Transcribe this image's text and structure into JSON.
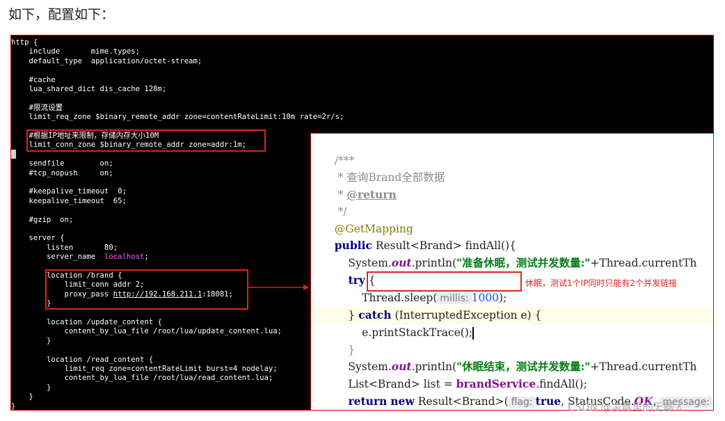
{
  "heading": "如下，配置如下：",
  "terminal": {
    "lines": [
      "http {",
      "    include       mime.types;",
      "    default_type  application/octet-stream;",
      "",
      "    #cache",
      "    lua_shared_dict dis_cache 128m;",
      "",
      "    #限流设置",
      "    limit_req_zone $binary_remote_addr zone=contentRateLimit:10m rate=2r/s;",
      "",
      "    #根据IP地址来限制，存储内存大小10M",
      "    limit_conn_zone $binary_remote_addr zone=addr:1m;",
      "",
      "    sendfile        on;",
      "    #tcp_nopush     on;",
      "",
      "    #keepalive_timeout  0;",
      "    keepalive_timeout  65;",
      "",
      "    #gzip  on;",
      "",
      "    server {",
      "        listen       80;",
      "        server_name  ",
      "",
      "        location /brand {",
      "            limit_conn addr 2;",
      "            proxy_pass ",
      "        }",
      "",
      "        location /update_content {",
      "            content_by_lua_file /root/lua/update_content.lua;",
      "        }",
      "",
      "        location /read_content {",
      "            limit_req zone=contentRateLimit burst=4 nodelay;",
      "            content_by_lua_file /root/lua/read_content.lua;",
      "        }",
      "    }",
      "}"
    ],
    "server_name_value": "localhost",
    "proxy_url": "http://192.168.211.1",
    "proxy_port": ":18081;"
  },
  "ide": {
    "doc_open": "/***",
    "doc_line": " * 查询Brand全部数据",
    "doc_star": " * ",
    "doc_tag": "@return",
    "doc_close": " */",
    "annotation": "@GetMapping",
    "kw_public": "public",
    "method_sig": " Result<Brand> findAll(){",
    "sys1": "    System.",
    "out": "out",
    "println_open": ".println(",
    "str1": "\"准备休眠，测试并发数量:\"",
    "sys1_tail": "+Thread.currentTh",
    "kw_try": "try",
    "brace_open": " {",
    "sleep_call": "Thread.sleep(",
    "hint_millis": "millis:",
    "sleep_value": "1000",
    "sleep_close": ");",
    "catch_prefix": "    } ",
    "kw_catch": "catch",
    "catch_tail": " (InterruptedException e) {",
    "stack_trace": "e.printStackTrace();",
    "close_inner": "    }",
    "str2": "\"休眠结束，测试并发数量:\"",
    "list_decl": "    List<Brand> list = ",
    "service": "brandService",
    "find_all": ".findAll();",
    "kw_return": "return",
    "kw_new": "new",
    "result_new": " Result<Brand>(",
    "hint_flag": "flag:",
    "kw_true": "true",
    "status_code": ", StatusCode.",
    "ok": "OK",
    "hint_message": "message:",
    "msg_tail": "\"",
    "close_method": "}"
  },
  "annotation_note": "休眠，测试1个IP同时只能有2个并发链接",
  "watermark": "CSDN @凌晨里的无聊人",
  "colors": {
    "highlight_box": "#e0241b",
    "terminal_bg": "#000000",
    "hostname": "#ff55ff"
  }
}
